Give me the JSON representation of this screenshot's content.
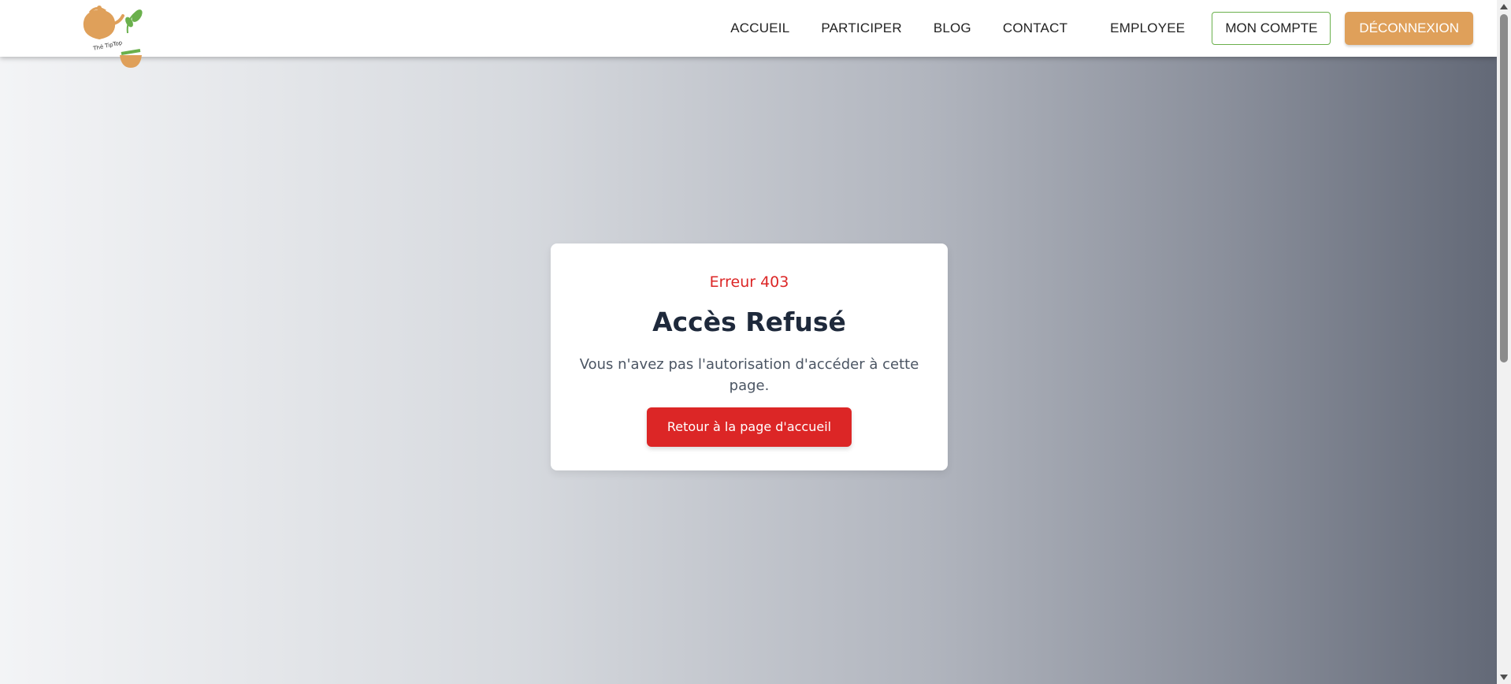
{
  "header": {
    "logo_text": "Thé TipTop",
    "nav": {
      "items": [
        {
          "label": "ACCUEIL"
        },
        {
          "label": "PARTICIPER"
        },
        {
          "label": "BLOG"
        },
        {
          "label": "CONTACT"
        },
        {
          "label": "EMPLOYEE"
        }
      ],
      "account_label": "MON COMPTE",
      "logout_label": "DÉCONNEXION"
    }
  },
  "error": {
    "code": "Erreur 403",
    "title": "Accès Refusé",
    "message": "Vous n'avez pas l'autorisation d'accéder à cette page.",
    "home_button": "Retour à la page d'accueil"
  },
  "colors": {
    "accent_orange": "#dfa05a",
    "accent_green": "#6ab04c",
    "error_red": "#dc2626"
  }
}
